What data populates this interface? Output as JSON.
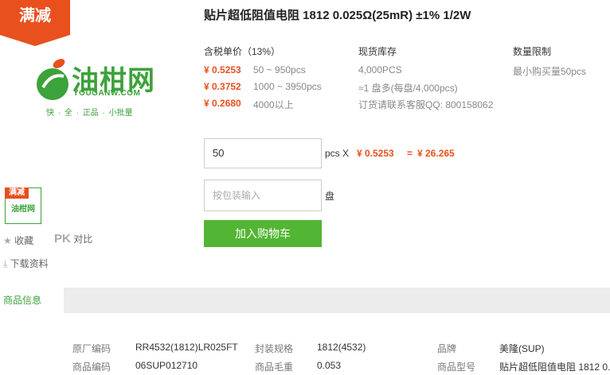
{
  "promo": {
    "badge": "满减"
  },
  "logo": {
    "name": "油柑网",
    "domain": "YOUGANW.COM",
    "slogan": "快 · 全 · 正品 · 小批量"
  },
  "thumbnail": {
    "badge": "满减",
    "logo_text": "油柑网"
  },
  "side_actions": {
    "favorite": "收藏",
    "pk": "PK",
    "compare": "对比",
    "download": "下载资料"
  },
  "product": {
    "title": "贴片超低阻值电阻 1812 0.025Ω(25mR) ±1% 1/2W",
    "price_header": "含税单价（13%）",
    "prices": [
      {
        "price": "¥ 0.5253",
        "range": "50 ~ 950pcs"
      },
      {
        "price": "¥ 0.3752",
        "range": "1000 ~ 3950pcs"
      },
      {
        "price": "¥ 0.2680",
        "range": "4000以上"
      }
    ],
    "stock_header": "现货库存",
    "stock": "4,000PCS",
    "stock_reels": "≈1 盘多(每盘/4,000pcs)",
    "stock_contact": "订货请联系客服QQ: 800158062",
    "limit_header": "数量限制",
    "limit_value": "最小购买量50pcs"
  },
  "order": {
    "quantity": "50",
    "unit_x": "pcs X",
    "unit_price": "¥ 0.5253",
    "equals": "=",
    "total": "¥ 26.265",
    "pack_placeholder": "按包装输入",
    "pack_unit": "盘",
    "cart_button": "加入购物车"
  },
  "tabs": {
    "active": "商品信息"
  },
  "specs": {
    "row1": {
      "k1": "原厂编码",
      "v1": "RR4532(1812)LR025FT",
      "k2": "封装规格",
      "v2": "1812(4532)",
      "k3": "品牌",
      "v3": "美隆(SUP)"
    },
    "row2": {
      "k1": "商品编码",
      "v1": "06SUP012710",
      "k2": "商品毛重",
      "v2": "0.053",
      "k3": "商品型号",
      "v3": "贴片超低阻值电阻 1812 0."
    }
  },
  "colors": {
    "accent_orange": "#e8501e",
    "brand_green": "#3ca23a",
    "button_green": "#52b533"
  }
}
